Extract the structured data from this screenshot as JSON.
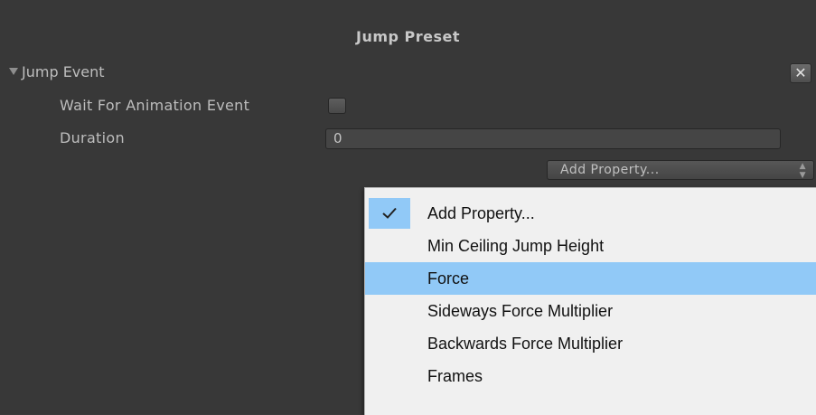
{
  "inspector": {
    "title": "Jump Preset",
    "foldout_label": "Jump Event",
    "close_glyph": "✕",
    "wait_label": "Wait For Animation Event",
    "wait_checked": false,
    "duration_label": "Duration",
    "duration_value": "0",
    "add_property_label": "Add Property..."
  },
  "dropdown": {
    "selected_index": 0,
    "highlighted_index": 2,
    "items": [
      {
        "label": "Add Property..."
      },
      {
        "label": "Min Ceiling Jump Height"
      },
      {
        "label": "Force"
      },
      {
        "label": "Sideways Force Multiplier"
      },
      {
        "label": "Backwards Force Multiplier"
      },
      {
        "label": "Frames"
      }
    ]
  },
  "colors": {
    "panel_bg": "#383838",
    "menu_bg": "#f0f0f0",
    "menu_highlight": "#91c9f7"
  },
  "icons": {
    "foldout": "triangle-down-icon",
    "close": "close-icon",
    "check": "checkmark-icon",
    "popup_arrows": "up-down-arrows-icon"
  }
}
